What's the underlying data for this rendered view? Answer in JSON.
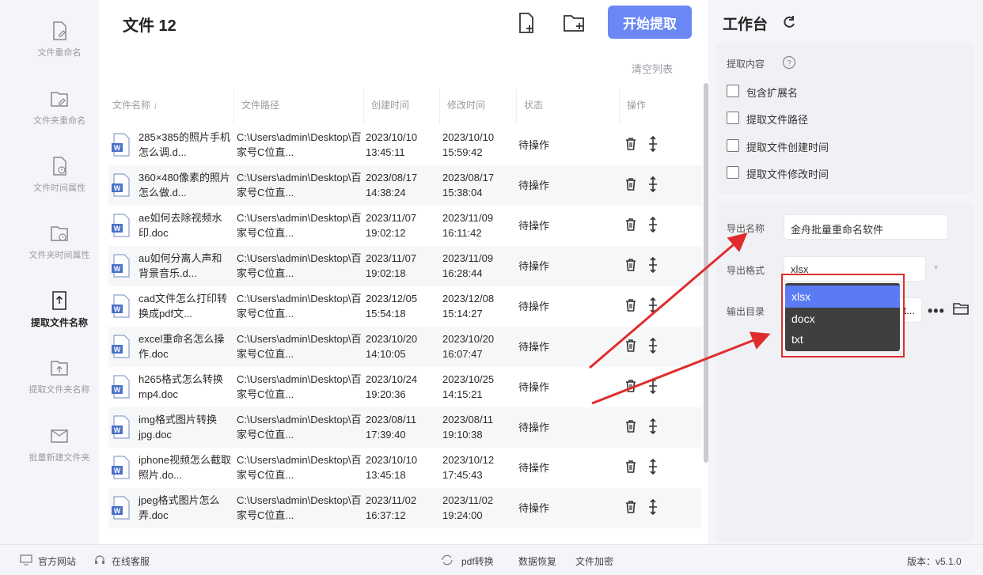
{
  "sidebar": {
    "items": [
      {
        "label": "文件重命名",
        "icon": "file-edit-icon",
        "active": false
      },
      {
        "label": "文件夹重命名",
        "icon": "folder-edit-icon",
        "active": false
      },
      {
        "label": "文件时间属性",
        "icon": "file-clock-icon",
        "active": false
      },
      {
        "label": "文件夹时间属性",
        "icon": "folder-clock-icon",
        "active": false
      },
      {
        "label": "提取文件名称",
        "icon": "file-export-icon",
        "active": true
      },
      {
        "label": "提取文件夹名称",
        "icon": "folder-export-icon",
        "active": false
      },
      {
        "label": "批量新建文件夹",
        "icon": "folder-add-icon",
        "active": false
      }
    ]
  },
  "main": {
    "title": "文件 12",
    "add_file_icon": "add-file-icon",
    "add_folder_icon": "add-folder-icon",
    "start_button": "开始提取",
    "clear_list": "清空列表",
    "columns": [
      "文件名称 ↓",
      "文件路径",
      "创建时间",
      "修改时间",
      "状态",
      "操作"
    ],
    "rows": [
      {
        "name": "285×385的照片手机怎么调.d...",
        "path": "C:\\Users\\admin\\Desktop\\百家号C位直...",
        "created": "2023/10/10 13:45:11",
        "modified": "2023/10/10 15:59:42",
        "status": "待操作"
      },
      {
        "name": "360×480像素的照片怎么做.d...",
        "path": "C:\\Users\\admin\\Desktop\\百家号C位直...",
        "created": "2023/08/17 14:38:24",
        "modified": "2023/08/17 15:38:04",
        "status": "待操作"
      },
      {
        "name": "ae如何去除视频水印.doc",
        "path": "C:\\Users\\admin\\Desktop\\百家号C位直...",
        "created": "2023/11/07 19:02:12",
        "modified": "2023/11/09 16:11:42",
        "status": "待操作"
      },
      {
        "name": "au如何分离人声和背景音乐.d...",
        "path": "C:\\Users\\admin\\Desktop\\百家号C位直...",
        "created": "2023/11/07 19:02:18",
        "modified": "2023/11/09 16:28:44",
        "status": "待操作"
      },
      {
        "name": "cad文件怎么打印转换成pdf文...",
        "path": "C:\\Users\\admin\\Desktop\\百家号C位直...",
        "created": "2023/12/05 15:54:18",
        "modified": "2023/12/08 15:14:27",
        "status": "待操作"
      },
      {
        "name": "excel重命名怎么操作.doc",
        "path": "C:\\Users\\admin\\Desktop\\百家号C位直...",
        "created": "2023/10/20 14:10:05",
        "modified": "2023/10/20 16:07:47",
        "status": "待操作"
      },
      {
        "name": "h265格式怎么转换mp4.doc",
        "path": "C:\\Users\\admin\\Desktop\\百家号C位直...",
        "created": "2023/10/24 19:20:36",
        "modified": "2023/10/25 14:15:21",
        "status": "待操作"
      },
      {
        "name": "img格式图片转换jpg.doc",
        "path": "C:\\Users\\admin\\Desktop\\百家号C位直...",
        "created": "2023/08/11 17:39:40",
        "modified": "2023/08/11 19:10:38",
        "status": "待操作"
      },
      {
        "name": "iphone视频怎么截取照片.do...",
        "path": "C:\\Users\\admin\\Desktop\\百家号C位直...",
        "created": "2023/10/10 13:45:18",
        "modified": "2023/10/12 17:45:43",
        "status": "待操作"
      },
      {
        "name": "jpeg格式图片怎么弄.doc",
        "path": "C:\\Users\\admin\\Desktop\\百家号C位直...",
        "created": "2023/11/02 16:37:12",
        "modified": "2023/11/02 19:24:00",
        "status": "待操作"
      }
    ]
  },
  "right_panel": {
    "title": "工作台",
    "extract_content_label": "提取内容",
    "options": [
      {
        "label": "包含扩展名",
        "checked": false
      },
      {
        "label": "提取文件路径",
        "checked": false
      },
      {
        "label": "提取文件创建时间",
        "checked": false
      },
      {
        "label": "提取文件修改时间",
        "checked": false
      }
    ],
    "export_name_label": "导出名称",
    "export_name_value": "金舟批量重命名软件",
    "export_format_label": "导出格式",
    "export_format_value": "xlsx",
    "output_dir_label": "输出目录",
    "output_dir_value": "t...",
    "more_label": "•••",
    "format_options": [
      "xlsx",
      "docx",
      "txt"
    ],
    "selected_format": "xlsx"
  },
  "footer": {
    "official_site": "官方网站",
    "online_service": "在线客服",
    "pdf_convert": "pdf转换",
    "data_recovery": "数据恢复",
    "file_encrypt": "文件加密",
    "version": "版本：v5.1.0"
  },
  "colors": {
    "accent": "#6a87f5",
    "dropdown_bg": "#3f3f3f",
    "dropdown_selected": "#5b7bf5",
    "annotation_red": "#e02c2c"
  }
}
